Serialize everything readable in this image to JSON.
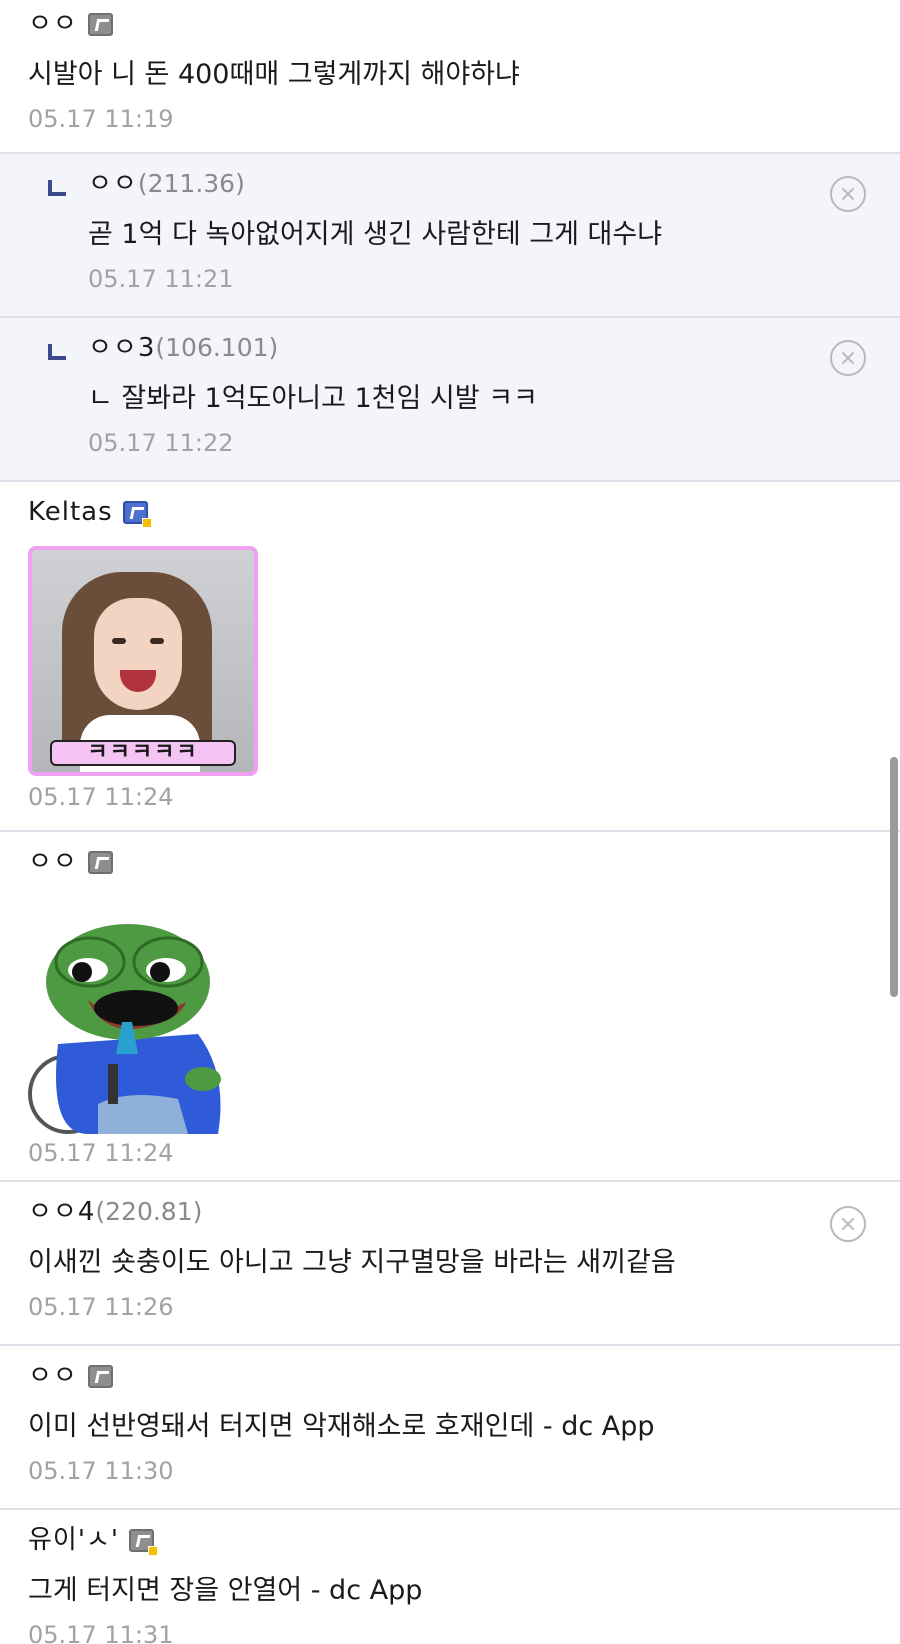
{
  "comments": [
    {
      "nick": "ㅇㅇ",
      "ip": "",
      "body": "시발아 니 돈 400때매 그렇게까지 해야하냐",
      "date": "05.17 11:19"
    },
    {
      "nick": "ㅇㅇ",
      "ip": "(211.36)",
      "body": "곧 1억 다 녹아없어지게 생긴 사람한테 그게 대수냐",
      "date": "05.17 11:21"
    },
    {
      "nick": "ㅇㅇ3",
      "ip": "(106.101)",
      "body": "ㄴ 잘봐라 1억도아니고 1천임 시발 ㅋㅋ",
      "date": "05.17 11:22"
    },
    {
      "nick": "Keltas",
      "ip": "",
      "dccon_text": "ㅋㅋㅋㅋㅋ",
      "date": "05.17 11:24"
    },
    {
      "nick": "ㅇㅇ",
      "ip": "",
      "date": "05.17 11:24"
    },
    {
      "nick": "ㅇㅇ4",
      "ip": "(220.81)",
      "body": "이새낀 숏충이도 아니고 그냥 지구멸망을 바라는 새끼같음",
      "date": "05.17 11:26"
    },
    {
      "nick": "ㅇㅇ",
      "ip": "",
      "body": "이미 선반영돼서 터지면 악재해소로 호재인데 - dc App",
      "date": "05.17 11:30"
    },
    {
      "nick": "유이'ㅅ'",
      "ip": "",
      "body": "그게 터지면 장을 안열어 - dc App",
      "date": "05.17 11:31"
    }
  ],
  "icons": {
    "fixed_nick": "fixed-nick-icon",
    "reply_arrow": "reply-arrow-icon",
    "delete": "delete-circle-x-icon"
  },
  "colors": {
    "reply_bg": "#f3f5fa",
    "divider": "#dfe1ea",
    "date": "#a2a2a2",
    "reply_arrow": "#3a4a8c"
  }
}
